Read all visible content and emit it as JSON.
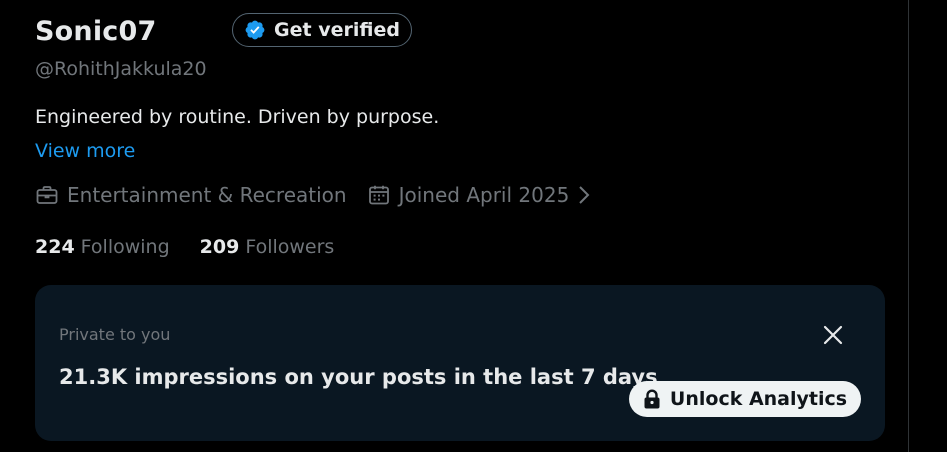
{
  "profile": {
    "display_name": "Sonic07",
    "handle": "@RohithJakkula20",
    "bio": "Engineered by routine. Driven by purpose.",
    "view_more_label": "View more",
    "verify_button_label": "Get verified",
    "category": "Entertainment & Recreation",
    "joined": "Joined April 2025",
    "following_count": "224",
    "following_label": "Following",
    "followers_count": "209",
    "followers_label": "Followers"
  },
  "analytics_card": {
    "private_label": "Private to you",
    "impressions_text": "21.3K impressions on your posts in the last 7 days",
    "unlock_button_label": "Unlock Analytics"
  },
  "icons": {
    "verified": "verified-badge-icon",
    "category": "briefcase-icon",
    "joined": "calendar-icon",
    "joined_more": "chevron-right-icon",
    "close": "close-icon",
    "unlock": "lock-icon"
  },
  "colors": {
    "background": "#000000",
    "text_primary": "#e7e9ea",
    "text_secondary": "#71767b",
    "accent": "#1d9bf0",
    "card_background": "#0a1722",
    "button_light": "#eff3f4"
  }
}
